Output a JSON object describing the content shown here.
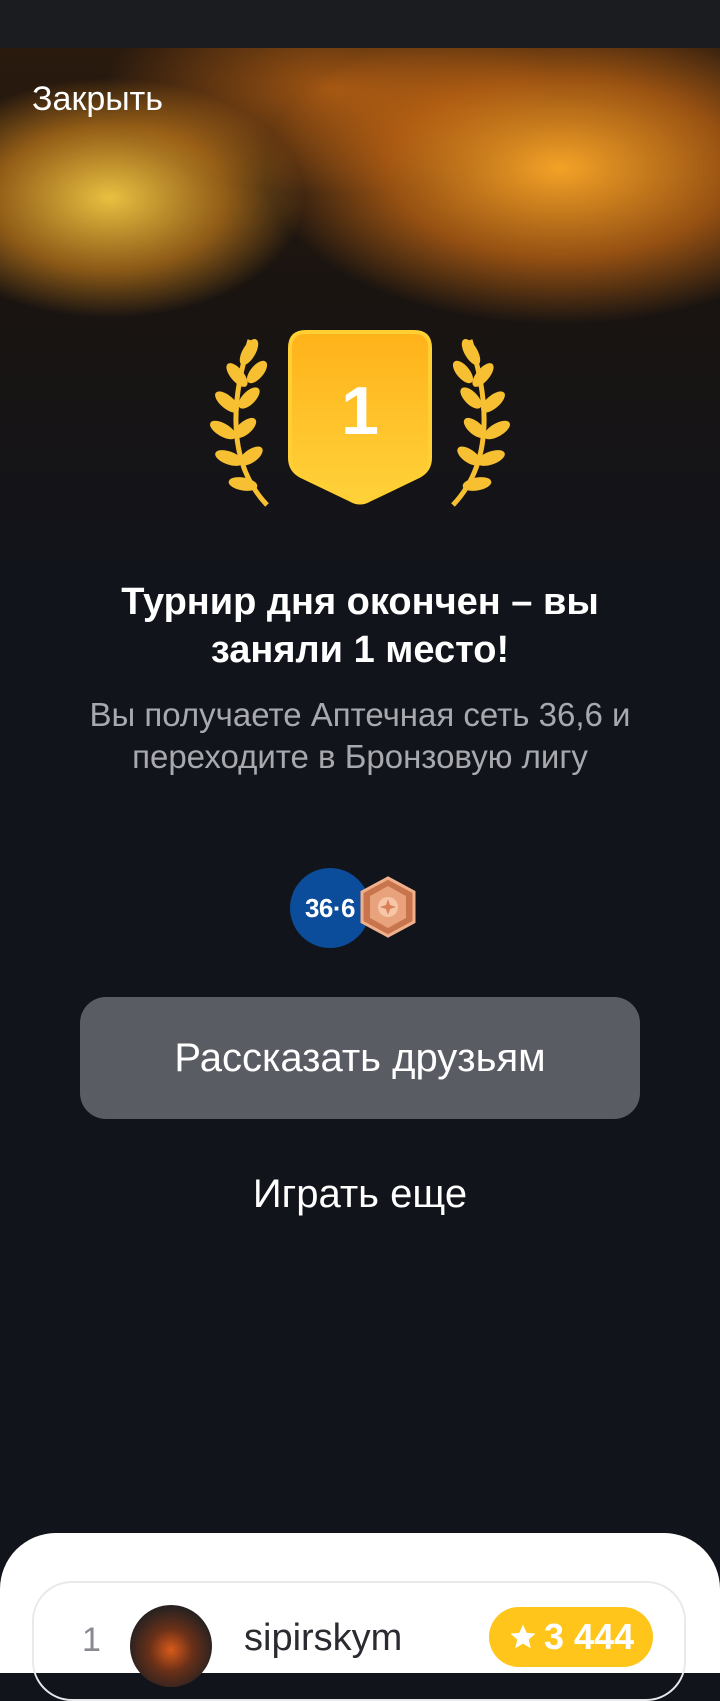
{
  "header": {
    "close_label": "Закрыть"
  },
  "result": {
    "place_number": "1",
    "title": "Турнир дня окончен – вы заняли 1 место!",
    "subtitle": "Вы получаете Аптечная сеть 36,6 и переходите в Бронзовую лигу"
  },
  "rewards": {
    "partner_logo_text": "36·6",
    "league_badge_icon": "bronze-league-hexagon-icon",
    "colors": {
      "partner": "#0b4c9b",
      "bronze": "#e0906a",
      "gold": "#ffc51a"
    }
  },
  "actions": {
    "share_label": "Рассказать друзьям",
    "play_again_label": "Играть еще"
  },
  "leaderboard": {
    "rows": [
      {
        "rank": "1",
        "username": "sipirskym",
        "score": "3 444",
        "score_icon": "star-icon"
      }
    ]
  }
}
